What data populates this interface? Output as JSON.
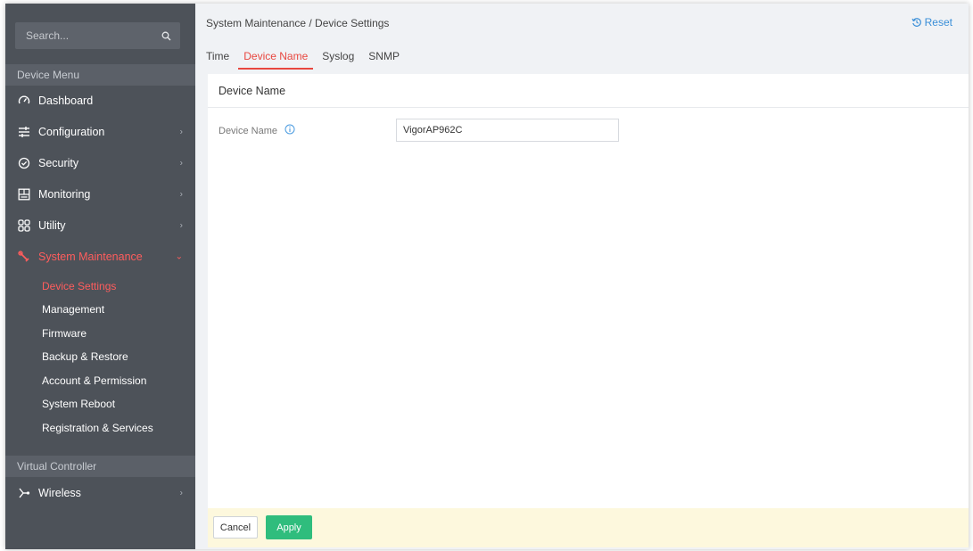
{
  "search": {
    "placeholder": "Search..."
  },
  "sidebar": {
    "device_menu_title": "Device Menu",
    "items": [
      {
        "label": "Dashboard",
        "icon": "dashboard-gauge-icon"
      },
      {
        "label": "Configuration",
        "icon": "configuration-sliders-icon"
      },
      {
        "label": "Security",
        "icon": "security-shield-icon"
      },
      {
        "label": "Monitoring",
        "icon": "monitoring-grid-icon"
      },
      {
        "label": "Utility",
        "icon": "utility-tiles-icon"
      },
      {
        "label": "System Maintenance",
        "icon": "wrench-icon"
      }
    ],
    "sub_items": [
      {
        "label": "Device Settings"
      },
      {
        "label": "Management"
      },
      {
        "label": "Firmware"
      },
      {
        "label": "Backup & Restore"
      },
      {
        "label": "Account & Permission"
      },
      {
        "label": "System Reboot"
      },
      {
        "label": "Registration & Services"
      }
    ],
    "virtual_controller_title": "Virtual Controller",
    "wireless": {
      "label": "Wireless",
      "icon": "wireless-network-icon"
    },
    "accent_color": "#ff5d5d"
  },
  "header": {
    "breadcrumb": "System Maintenance / Device Settings",
    "reset_label": "Reset"
  },
  "tabs": [
    {
      "label": "Time"
    },
    {
      "label": "Device Name"
    },
    {
      "label": "Syslog"
    },
    {
      "label": "SNMP"
    }
  ],
  "panel": {
    "title": "Device Name",
    "field_label": "Device Name",
    "field_value": "VigorAP962C"
  },
  "footer": {
    "cancel_label": "Cancel",
    "apply_label": "Apply",
    "apply_color": "#2fbd7d"
  }
}
